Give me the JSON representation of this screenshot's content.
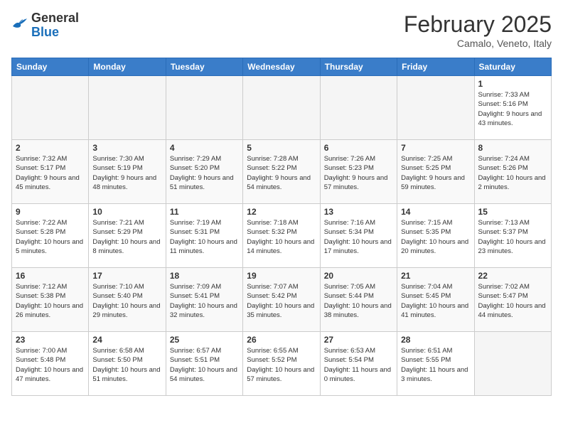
{
  "header": {
    "logo_line1": "General",
    "logo_line2": "Blue",
    "title": "February 2025",
    "subtitle": "Camalo, Veneto, Italy"
  },
  "days_of_week": [
    "Sunday",
    "Monday",
    "Tuesday",
    "Wednesday",
    "Thursday",
    "Friday",
    "Saturday"
  ],
  "weeks": [
    [
      {
        "day": "",
        "info": ""
      },
      {
        "day": "",
        "info": ""
      },
      {
        "day": "",
        "info": ""
      },
      {
        "day": "",
        "info": ""
      },
      {
        "day": "",
        "info": ""
      },
      {
        "day": "",
        "info": ""
      },
      {
        "day": "1",
        "info": "Sunrise: 7:33 AM\nSunset: 5:16 PM\nDaylight: 9 hours and 43 minutes."
      }
    ],
    [
      {
        "day": "2",
        "info": "Sunrise: 7:32 AM\nSunset: 5:17 PM\nDaylight: 9 hours and 45 minutes."
      },
      {
        "day": "3",
        "info": "Sunrise: 7:30 AM\nSunset: 5:19 PM\nDaylight: 9 hours and 48 minutes."
      },
      {
        "day": "4",
        "info": "Sunrise: 7:29 AM\nSunset: 5:20 PM\nDaylight: 9 hours and 51 minutes."
      },
      {
        "day": "5",
        "info": "Sunrise: 7:28 AM\nSunset: 5:22 PM\nDaylight: 9 hours and 54 minutes."
      },
      {
        "day": "6",
        "info": "Sunrise: 7:26 AM\nSunset: 5:23 PM\nDaylight: 9 hours and 57 minutes."
      },
      {
        "day": "7",
        "info": "Sunrise: 7:25 AM\nSunset: 5:25 PM\nDaylight: 9 hours and 59 minutes."
      },
      {
        "day": "8",
        "info": "Sunrise: 7:24 AM\nSunset: 5:26 PM\nDaylight: 10 hours and 2 minutes."
      }
    ],
    [
      {
        "day": "9",
        "info": "Sunrise: 7:22 AM\nSunset: 5:28 PM\nDaylight: 10 hours and 5 minutes."
      },
      {
        "day": "10",
        "info": "Sunrise: 7:21 AM\nSunset: 5:29 PM\nDaylight: 10 hours and 8 minutes."
      },
      {
        "day": "11",
        "info": "Sunrise: 7:19 AM\nSunset: 5:31 PM\nDaylight: 10 hours and 11 minutes."
      },
      {
        "day": "12",
        "info": "Sunrise: 7:18 AM\nSunset: 5:32 PM\nDaylight: 10 hours and 14 minutes."
      },
      {
        "day": "13",
        "info": "Sunrise: 7:16 AM\nSunset: 5:34 PM\nDaylight: 10 hours and 17 minutes."
      },
      {
        "day": "14",
        "info": "Sunrise: 7:15 AM\nSunset: 5:35 PM\nDaylight: 10 hours and 20 minutes."
      },
      {
        "day": "15",
        "info": "Sunrise: 7:13 AM\nSunset: 5:37 PM\nDaylight: 10 hours and 23 minutes."
      }
    ],
    [
      {
        "day": "16",
        "info": "Sunrise: 7:12 AM\nSunset: 5:38 PM\nDaylight: 10 hours and 26 minutes."
      },
      {
        "day": "17",
        "info": "Sunrise: 7:10 AM\nSunset: 5:40 PM\nDaylight: 10 hours and 29 minutes."
      },
      {
        "day": "18",
        "info": "Sunrise: 7:09 AM\nSunset: 5:41 PM\nDaylight: 10 hours and 32 minutes."
      },
      {
        "day": "19",
        "info": "Sunrise: 7:07 AM\nSunset: 5:42 PM\nDaylight: 10 hours and 35 minutes."
      },
      {
        "day": "20",
        "info": "Sunrise: 7:05 AM\nSunset: 5:44 PM\nDaylight: 10 hours and 38 minutes."
      },
      {
        "day": "21",
        "info": "Sunrise: 7:04 AM\nSunset: 5:45 PM\nDaylight: 10 hours and 41 minutes."
      },
      {
        "day": "22",
        "info": "Sunrise: 7:02 AM\nSunset: 5:47 PM\nDaylight: 10 hours and 44 minutes."
      }
    ],
    [
      {
        "day": "23",
        "info": "Sunrise: 7:00 AM\nSunset: 5:48 PM\nDaylight: 10 hours and 47 minutes."
      },
      {
        "day": "24",
        "info": "Sunrise: 6:58 AM\nSunset: 5:50 PM\nDaylight: 10 hours and 51 minutes."
      },
      {
        "day": "25",
        "info": "Sunrise: 6:57 AM\nSunset: 5:51 PM\nDaylight: 10 hours and 54 minutes."
      },
      {
        "day": "26",
        "info": "Sunrise: 6:55 AM\nSunset: 5:52 PM\nDaylight: 10 hours and 57 minutes."
      },
      {
        "day": "27",
        "info": "Sunrise: 6:53 AM\nSunset: 5:54 PM\nDaylight: 11 hours and 0 minutes."
      },
      {
        "day": "28",
        "info": "Sunrise: 6:51 AM\nSunset: 5:55 PM\nDaylight: 11 hours and 3 minutes."
      },
      {
        "day": "",
        "info": ""
      }
    ]
  ]
}
